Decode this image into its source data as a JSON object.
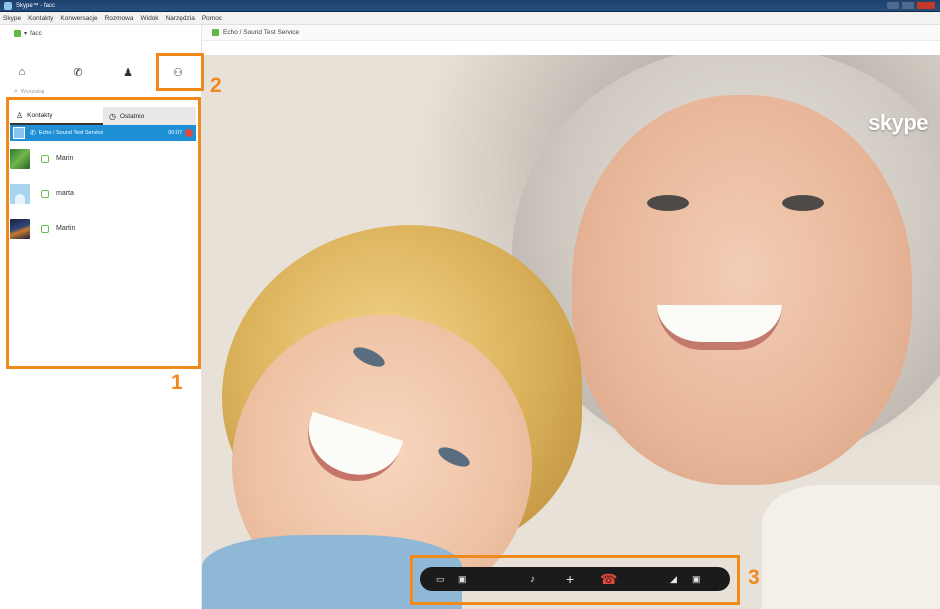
{
  "window": {
    "title": "Skype™ - facc"
  },
  "menu": [
    "Skype",
    "Kontakty",
    "Konwersacje",
    "Rozmowa",
    "Widok",
    "Narzędzia",
    "Pomoc"
  ],
  "user": {
    "name": "facc"
  },
  "search": {
    "placeholder": "Wyszukaj"
  },
  "tabs": [
    {
      "label": "Kontakty",
      "icon": "person-icon"
    },
    {
      "label": "Ostatnio",
      "icon": "clock-icon"
    }
  ],
  "active_call": {
    "name": "Echo / Sound Test Service",
    "duration": "00:07"
  },
  "contacts": [
    {
      "name": "Marin",
      "status": "online"
    },
    {
      "name": "marta",
      "status": "online"
    },
    {
      "name": "Martin",
      "status": "online"
    }
  ],
  "conversation": {
    "title": "Echo / Sound Test Service"
  },
  "logo": "skype",
  "annotations": [
    "1",
    "2",
    "3"
  ],
  "colors": {
    "accent": "#1f8fd6",
    "annotation": "#f08a1c",
    "hangup": "#e04a3a",
    "online": "#5fb944"
  }
}
